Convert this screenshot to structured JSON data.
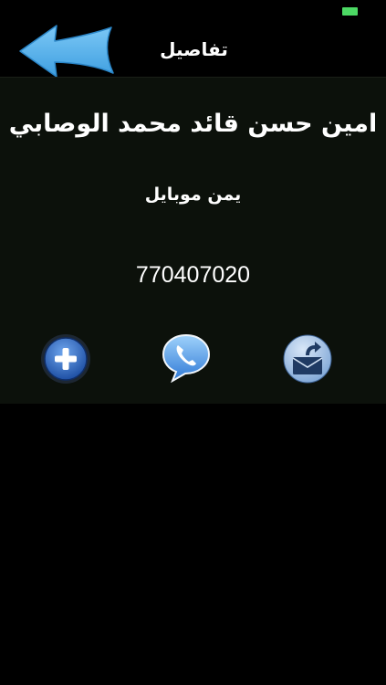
{
  "header": {
    "title": "تفاصيل"
  },
  "contact": {
    "name": "امين حسن قائد محمد الوصابي",
    "company": "يمن موبايل",
    "phone": "770407020"
  },
  "colors": {
    "background": "#000000",
    "panel": "#0c110b",
    "back_arrow": "#5ab6f0",
    "battery": "#4cd964"
  },
  "icons": {
    "back": "arrow-left-icon",
    "add": "plus-circle-icon",
    "call": "phone-bubble-icon",
    "message": "envelope-send-icon"
  }
}
